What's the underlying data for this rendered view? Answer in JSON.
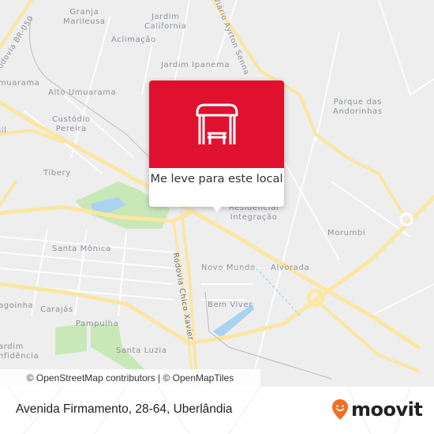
{
  "map": {
    "neighborhoods": [
      {
        "id": "granja-marileusa",
        "lines": [
          "Granja",
          "Marileusa"
        ]
      },
      {
        "id": "jardim-california",
        "lines": [
          "Jardim",
          "California"
        ]
      },
      {
        "id": "aclimacao",
        "lines": [
          "Aclimação"
        ]
      },
      {
        "id": "jardim-ipanema",
        "lines": [
          "Jardim Ipanema"
        ]
      },
      {
        "id": "umuarama",
        "lines": [
          "Umuarama"
        ]
      },
      {
        "id": "alto-umuarama",
        "lines": [
          "Alto Umuarama"
        ]
      },
      {
        "id": "custodio-pereira",
        "lines": [
          "Custódio",
          "Pereira"
        ]
      },
      {
        "id": "brasil",
        "lines": [
          "sil"
        ]
      },
      {
        "id": "parque-das-andorinhas",
        "lines": [
          "Parque das",
          "Andorinhas"
        ]
      },
      {
        "id": "tibery",
        "lines": [
          "Tibery"
        ]
      },
      {
        "id": "residencial-integracao",
        "lines": [
          "Residencial",
          "Integração"
        ]
      },
      {
        "id": "morumbi",
        "lines": [
          "Morumbi"
        ]
      },
      {
        "id": "santa-monica",
        "lines": [
          "Santa Mônica"
        ]
      },
      {
        "id": "novo-mundo",
        "lines": [
          "Novo Mundo"
        ]
      },
      {
        "id": "alvorada",
        "lines": [
          "Alvorada"
        ]
      },
      {
        "id": "bem-viver",
        "lines": [
          "Bem Viver"
        ]
      },
      {
        "id": "lagoinha",
        "lines": [
          "agoinha"
        ]
      },
      {
        "id": "carajas",
        "lines": [
          "Carajás"
        ]
      },
      {
        "id": "pampulha",
        "lines": [
          "Pampulha"
        ]
      },
      {
        "id": "jardim-inconfidencia",
        "lines": [
          "ardim",
          "nfidência"
        ]
      },
      {
        "id": "santa-luzia",
        "lines": [
          "Santa Luzia"
        ]
      }
    ],
    "roads": {
      "br050": "odovia BR-050",
      "ayrton_senna": "Viário Ayrton Senna",
      "chico_xavier": "Rodovia Chico Xavier"
    },
    "attribution": "© OpenStreetMap contributors | © OpenMapTiles"
  },
  "popup": {
    "icon": "bus-stop-icon",
    "text": "Me leve para este local",
    "color": "#e0102f"
  },
  "footer": {
    "address": "Avenida Firmamento, 28-64, Uberlândia",
    "logo_text": "moovit",
    "logo_color": "#f36f21"
  }
}
